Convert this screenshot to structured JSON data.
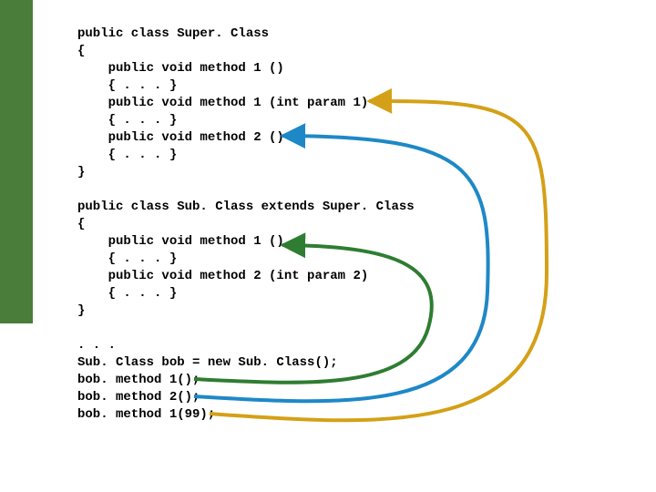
{
  "code": {
    "l1": "public class Super. Class",
    "l2": "{",
    "l3": "    public void method 1 ()",
    "l4": "    { . . . }",
    "l5": "    public void method 1 (int param 1)",
    "l6": "    { . . . }",
    "l7": "    public void method 2 ()",
    "l8": "    { . . . }",
    "l9": "}",
    "l10": "",
    "l11": "public class Sub. Class extends Super. Class",
    "l12": "{",
    "l13": "    public void method 1 ()",
    "l14": "    { . . . }",
    "l15": "    public void method 2 (int param 2)",
    "l16": "    { . . . }",
    "l17": "}",
    "l18": "",
    "l19": ". . .",
    "l20": "Sub. Class bob = new Sub. Class();",
    "l21": "bob. method 1();",
    "l22": "bob. method 2();",
    "l23": "bob. method 1(99);"
  },
  "arrows": {
    "green": {
      "from": "bob.method1()",
      "to": "Sub.Class method1()",
      "color": "#2e7d32"
    },
    "blue": {
      "from": "bob.method2()",
      "to": "Super.Class method2()",
      "color": "#1e88c7"
    },
    "yellow": {
      "from": "bob.method1(99)",
      "to": "Super.Class method1(int)",
      "color": "#d4a017"
    }
  }
}
